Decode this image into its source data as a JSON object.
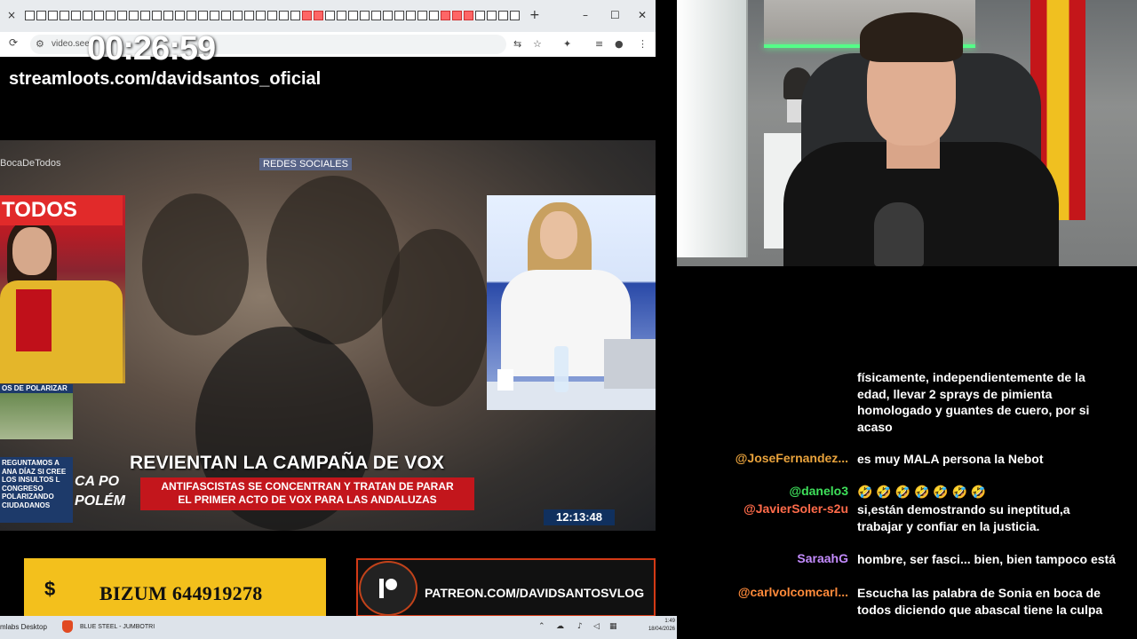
{
  "stream_overlay": {
    "timer": "00:26:59",
    "streamloots": "streamloots.com/davidsantos_oficial"
  },
  "browser": {
    "url": "video.seel",
    "close_tab": "×",
    "new_tab": "+",
    "minimize": "–",
    "maximize": "☐",
    "close_window": "✕"
  },
  "video": {
    "watermark": "BocaDeTodos",
    "social_tag": "REDES SOCIALES",
    "left_logo": "TODOS",
    "polarizar_tag": "OS DE POLARIZAR",
    "question": "REGUNTAMOS A ANA DÍAZ SI CREE LOS INSULTOS L CONGRESO POLARIZANDO CIUDADANOS",
    "headline": "REVIENTAN LA CAMPAÑA DE VOX",
    "subheadline_1": "ANTIFASCISTAS SE CONCENTRAN Y TRATAN DE PARAR",
    "subheadline_2": "EL PRIMER ACTO DE VOX PARA LAS ANDALUZAS",
    "ticker_left_1": "CA   PO",
    "ticker_left_2": "POLÉM",
    "clock": "12:13:48"
  },
  "donations": {
    "bizum_symbol": "$",
    "bizum": "BIZUM 644919278",
    "patreon": "PATREON.COM/DAVIDSANTOSVLOG"
  },
  "taskbar": {
    "app": "mlabs Desktop",
    "window_title": "BLUE STEEL - JUMBOTRI",
    "time": "1:49",
    "date": "18/04/2026"
  },
  "chat": {
    "messages": [
      {
        "user": "",
        "user_color": "#ffffff",
        "text": "físicamente, independientemente de la edad, llevar 2 sprays de pimienta homologado y guantes de cuero, por si acaso"
      },
      {
        "user": "@JoseFernandez...",
        "user_color": "#e8a23c",
        "text": "es muy MALA persona la Nebot"
      },
      {
        "user": "@danelo3",
        "user_color": "#3ee05a",
        "text": "🤣 🤣 🤣 🤣 🤣 🤣 🤣"
      },
      {
        "user": "@JavierSoler-s2u",
        "user_color": "#ff6b4a",
        "text": "si,están demostrando su ineptitud,a trabajar y confiar en la justicia."
      },
      {
        "user": "SaraahG",
        "user_color": "#c48cff",
        "text": "hombre, ser fasci... bien, bien tampoco está"
      },
      {
        "user": "@carlvolcomcarl...",
        "user_color": "#ff8a3a",
        "text": "Escucha las palabra de Sonia en boca de todos diciendo que abascal tiene la culpa"
      }
    ]
  }
}
